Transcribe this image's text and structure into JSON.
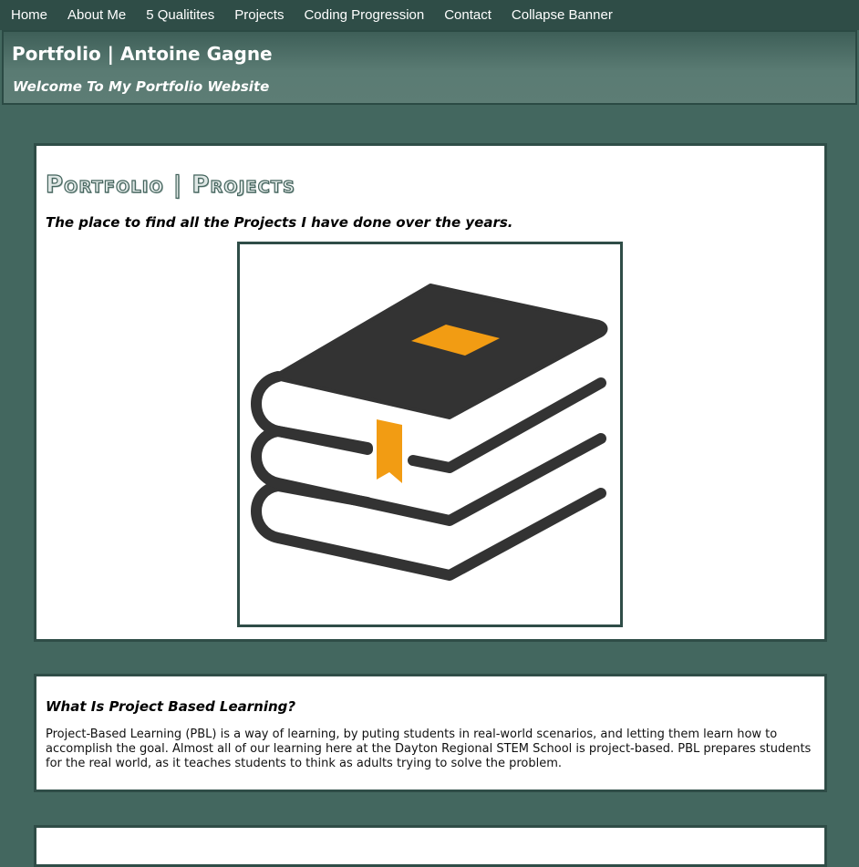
{
  "nav": {
    "items": [
      {
        "label": "Home"
      },
      {
        "label": "About Me"
      },
      {
        "label": "5 Qualitites"
      },
      {
        "label": "Projects"
      },
      {
        "label": "Coding Progression"
      },
      {
        "label": "Contact"
      },
      {
        "label": "Collapse Banner"
      }
    ]
  },
  "banner": {
    "title": "Portfolio | Antoine Gagne",
    "subtitle": "Welcome To My Portfolio Website"
  },
  "projects_card": {
    "heading": "Portfolio | Projects",
    "tagline": "The place to find all the Projects I have done over the years.",
    "image_icon": "books-stack-icon"
  },
  "pbl_card": {
    "heading": "What Is Project Based Learning?",
    "body": "Project-Based Learning (PBL) is a way of learning, by puting students in real-world scenarios, and letting them learn how to accomplish the goal. Almost all of our learning here at the Dayton Regional STEM School is project-based. PBL prepares students for the real world, as it teaches students to think as adults trying to solve the problem."
  },
  "colors": {
    "page_background": "#43675f",
    "nav_background": "#2f4d47",
    "card_border": "#2f4d47",
    "book_dark": "#333333",
    "book_accent": "#f29c13"
  }
}
